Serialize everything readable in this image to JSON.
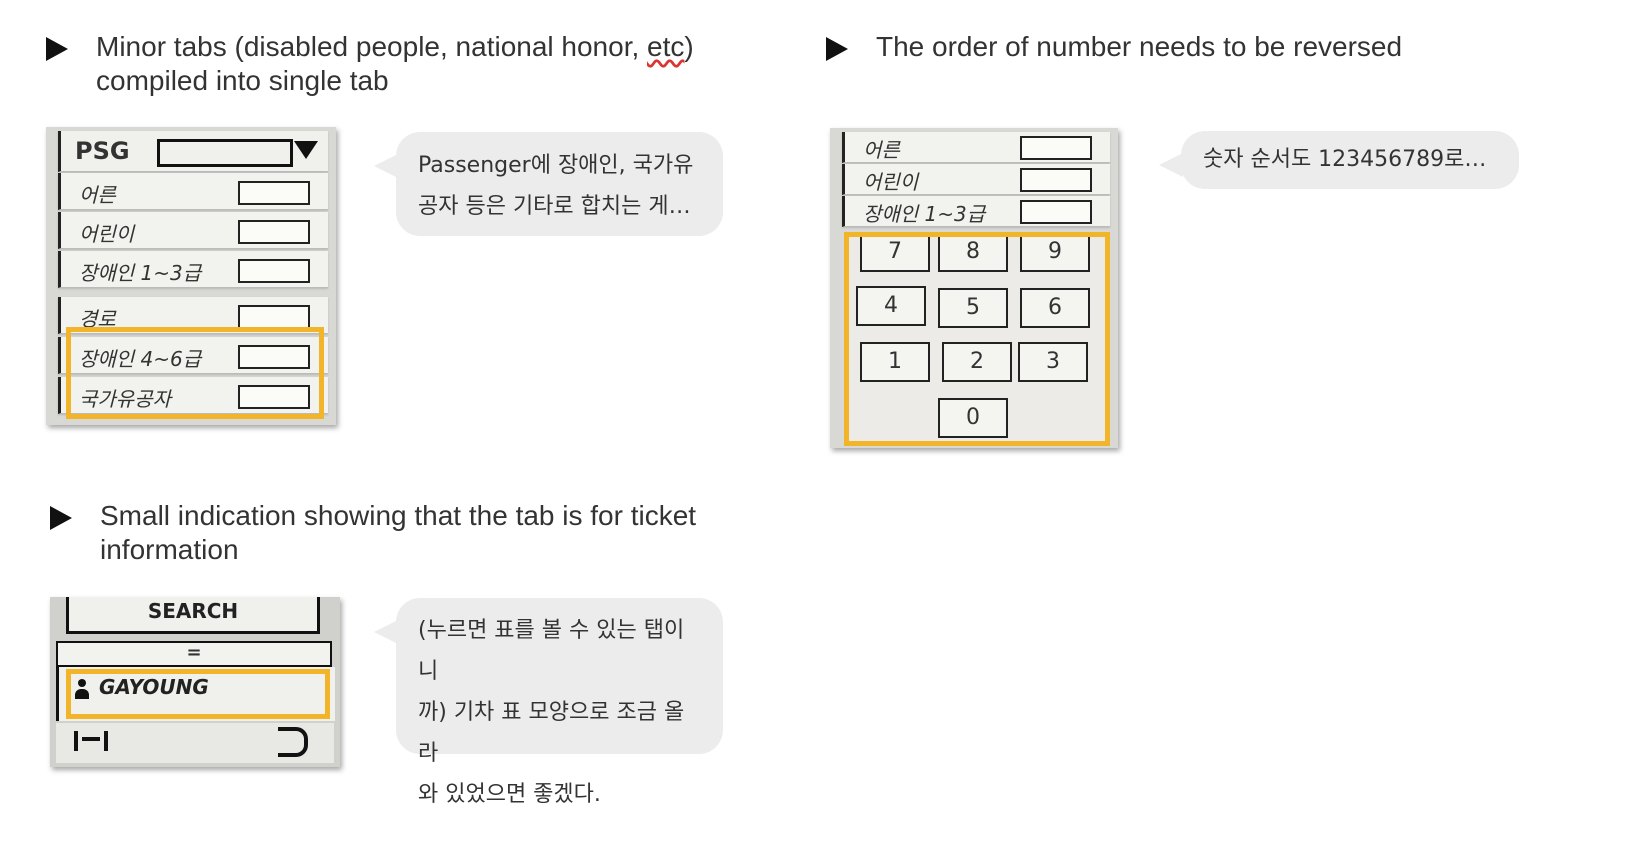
{
  "sections": {
    "minor_tabs": {
      "heading_line1_prefix": "Minor tabs (disabled people, national honor, ",
      "heading_line1_wavy": "etc",
      "heading_line1_suffix": ")",
      "heading_line2": "compiled into single tab",
      "comment": [
        "Passenger에 장애인, 국가유",
        "공자 등은 기타로 합치는 게…"
      ],
      "sketch": {
        "header_label": "PSG",
        "rows": [
          "어른",
          "어린이",
          "장애인 1~3급",
          "경로",
          "장애인 4~6급",
          "국가유공자"
        ]
      }
    },
    "number_order": {
      "heading": "The order of number needs to be reversed",
      "comment": [
        "숫자 순서도 123456789로…"
      ],
      "sketch": {
        "rows": [
          "어른",
          "어린이",
          "장애인 1~3급"
        ],
        "keys": [
          "7",
          "8",
          "9",
          "4",
          "5",
          "6",
          "1",
          "2",
          "3",
          "0"
        ]
      }
    },
    "ticket_indication": {
      "heading_line1": "Small indication showing that the tab is for ticket",
      "heading_line2": "information",
      "comment": [
        "(누르면 표를 볼 수 있는 탭이니",
        "까) 기차 표 모양으로 조금 올라",
        "와 있었으면 좋겠다."
      ],
      "sketch": {
        "search_label": "SEARCH",
        "user_label": "GAYOUNG",
        "divider_glyph": "="
      }
    }
  },
  "colors": {
    "highlight": "#f2b52a",
    "bubble": "#ececec",
    "bullet": "#111111"
  }
}
